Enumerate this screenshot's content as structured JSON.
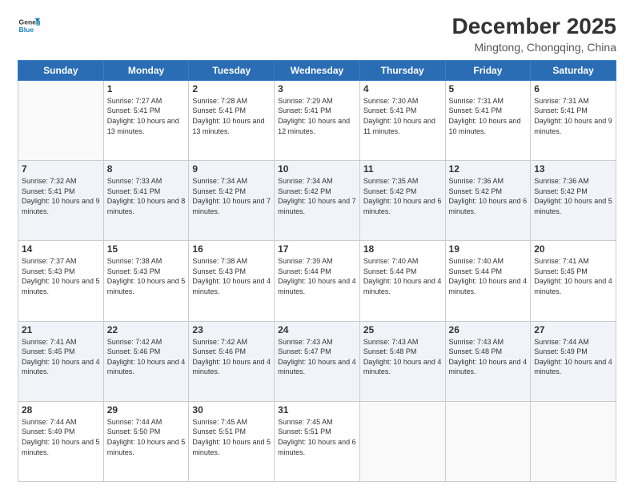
{
  "header": {
    "logo_general": "General",
    "logo_blue": "Blue",
    "month_title": "December 2025",
    "location": "Mingtong, Chongqing, China"
  },
  "days_of_week": [
    "Sunday",
    "Monday",
    "Tuesday",
    "Wednesday",
    "Thursday",
    "Friday",
    "Saturday"
  ],
  "weeks": [
    [
      {
        "day": "",
        "info": ""
      },
      {
        "day": "1",
        "info": "Sunrise: 7:27 AM\nSunset: 5:41 PM\nDaylight: 10 hours\nand 13 minutes."
      },
      {
        "day": "2",
        "info": "Sunrise: 7:28 AM\nSunset: 5:41 PM\nDaylight: 10 hours\nand 13 minutes."
      },
      {
        "day": "3",
        "info": "Sunrise: 7:29 AM\nSunset: 5:41 PM\nDaylight: 10 hours\nand 12 minutes."
      },
      {
        "day": "4",
        "info": "Sunrise: 7:30 AM\nSunset: 5:41 PM\nDaylight: 10 hours\nand 11 minutes."
      },
      {
        "day": "5",
        "info": "Sunrise: 7:31 AM\nSunset: 5:41 PM\nDaylight: 10 hours\nand 10 minutes."
      },
      {
        "day": "6",
        "info": "Sunrise: 7:31 AM\nSunset: 5:41 PM\nDaylight: 10 hours\nand 9 minutes."
      }
    ],
    [
      {
        "day": "7",
        "info": "Sunrise: 7:32 AM\nSunset: 5:41 PM\nDaylight: 10 hours\nand 9 minutes."
      },
      {
        "day": "8",
        "info": "Sunrise: 7:33 AM\nSunset: 5:41 PM\nDaylight: 10 hours\nand 8 minutes."
      },
      {
        "day": "9",
        "info": "Sunrise: 7:34 AM\nSunset: 5:42 PM\nDaylight: 10 hours\nand 7 minutes."
      },
      {
        "day": "10",
        "info": "Sunrise: 7:34 AM\nSunset: 5:42 PM\nDaylight: 10 hours\nand 7 minutes."
      },
      {
        "day": "11",
        "info": "Sunrise: 7:35 AM\nSunset: 5:42 PM\nDaylight: 10 hours\nand 6 minutes."
      },
      {
        "day": "12",
        "info": "Sunrise: 7:36 AM\nSunset: 5:42 PM\nDaylight: 10 hours\nand 6 minutes."
      },
      {
        "day": "13",
        "info": "Sunrise: 7:36 AM\nSunset: 5:42 PM\nDaylight: 10 hours\nand 5 minutes."
      }
    ],
    [
      {
        "day": "14",
        "info": "Sunrise: 7:37 AM\nSunset: 5:43 PM\nDaylight: 10 hours\nand 5 minutes."
      },
      {
        "day": "15",
        "info": "Sunrise: 7:38 AM\nSunset: 5:43 PM\nDaylight: 10 hours\nand 5 minutes."
      },
      {
        "day": "16",
        "info": "Sunrise: 7:38 AM\nSunset: 5:43 PM\nDaylight: 10 hours\nand 4 minutes."
      },
      {
        "day": "17",
        "info": "Sunrise: 7:39 AM\nSunset: 5:44 PM\nDaylight: 10 hours\nand 4 minutes."
      },
      {
        "day": "18",
        "info": "Sunrise: 7:40 AM\nSunset: 5:44 PM\nDaylight: 10 hours\nand 4 minutes."
      },
      {
        "day": "19",
        "info": "Sunrise: 7:40 AM\nSunset: 5:44 PM\nDaylight: 10 hours\nand 4 minutes."
      },
      {
        "day": "20",
        "info": "Sunrise: 7:41 AM\nSunset: 5:45 PM\nDaylight: 10 hours\nand 4 minutes."
      }
    ],
    [
      {
        "day": "21",
        "info": "Sunrise: 7:41 AM\nSunset: 5:45 PM\nDaylight: 10 hours\nand 4 minutes."
      },
      {
        "day": "22",
        "info": "Sunrise: 7:42 AM\nSunset: 5:46 PM\nDaylight: 10 hours\nand 4 minutes."
      },
      {
        "day": "23",
        "info": "Sunrise: 7:42 AM\nSunset: 5:46 PM\nDaylight: 10 hours\nand 4 minutes."
      },
      {
        "day": "24",
        "info": "Sunrise: 7:43 AM\nSunset: 5:47 PM\nDaylight: 10 hours\nand 4 minutes."
      },
      {
        "day": "25",
        "info": "Sunrise: 7:43 AM\nSunset: 5:48 PM\nDaylight: 10 hours\nand 4 minutes."
      },
      {
        "day": "26",
        "info": "Sunrise: 7:43 AM\nSunset: 5:48 PM\nDaylight: 10 hours\nand 4 minutes."
      },
      {
        "day": "27",
        "info": "Sunrise: 7:44 AM\nSunset: 5:49 PM\nDaylight: 10 hours\nand 4 minutes."
      }
    ],
    [
      {
        "day": "28",
        "info": "Sunrise: 7:44 AM\nSunset: 5:49 PM\nDaylight: 10 hours\nand 5 minutes."
      },
      {
        "day": "29",
        "info": "Sunrise: 7:44 AM\nSunset: 5:50 PM\nDaylight: 10 hours\nand 5 minutes."
      },
      {
        "day": "30",
        "info": "Sunrise: 7:45 AM\nSunset: 5:51 PM\nDaylight: 10 hours\nand 5 minutes."
      },
      {
        "day": "31",
        "info": "Sunrise: 7:45 AM\nSunset: 5:51 PM\nDaylight: 10 hours\nand 6 minutes."
      },
      {
        "day": "",
        "info": ""
      },
      {
        "day": "",
        "info": ""
      },
      {
        "day": "",
        "info": ""
      }
    ]
  ]
}
